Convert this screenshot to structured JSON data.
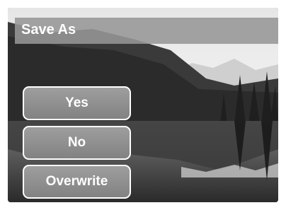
{
  "dialog": {
    "title": "Save As",
    "options": [
      {
        "label": "Yes"
      },
      {
        "label": "No"
      },
      {
        "label": "Overwrite"
      }
    ]
  },
  "colors": {
    "title_bar": "#969696",
    "button_fill": "#8f8f8f",
    "button_border": "#ffffff",
    "text": "#ffffff"
  }
}
